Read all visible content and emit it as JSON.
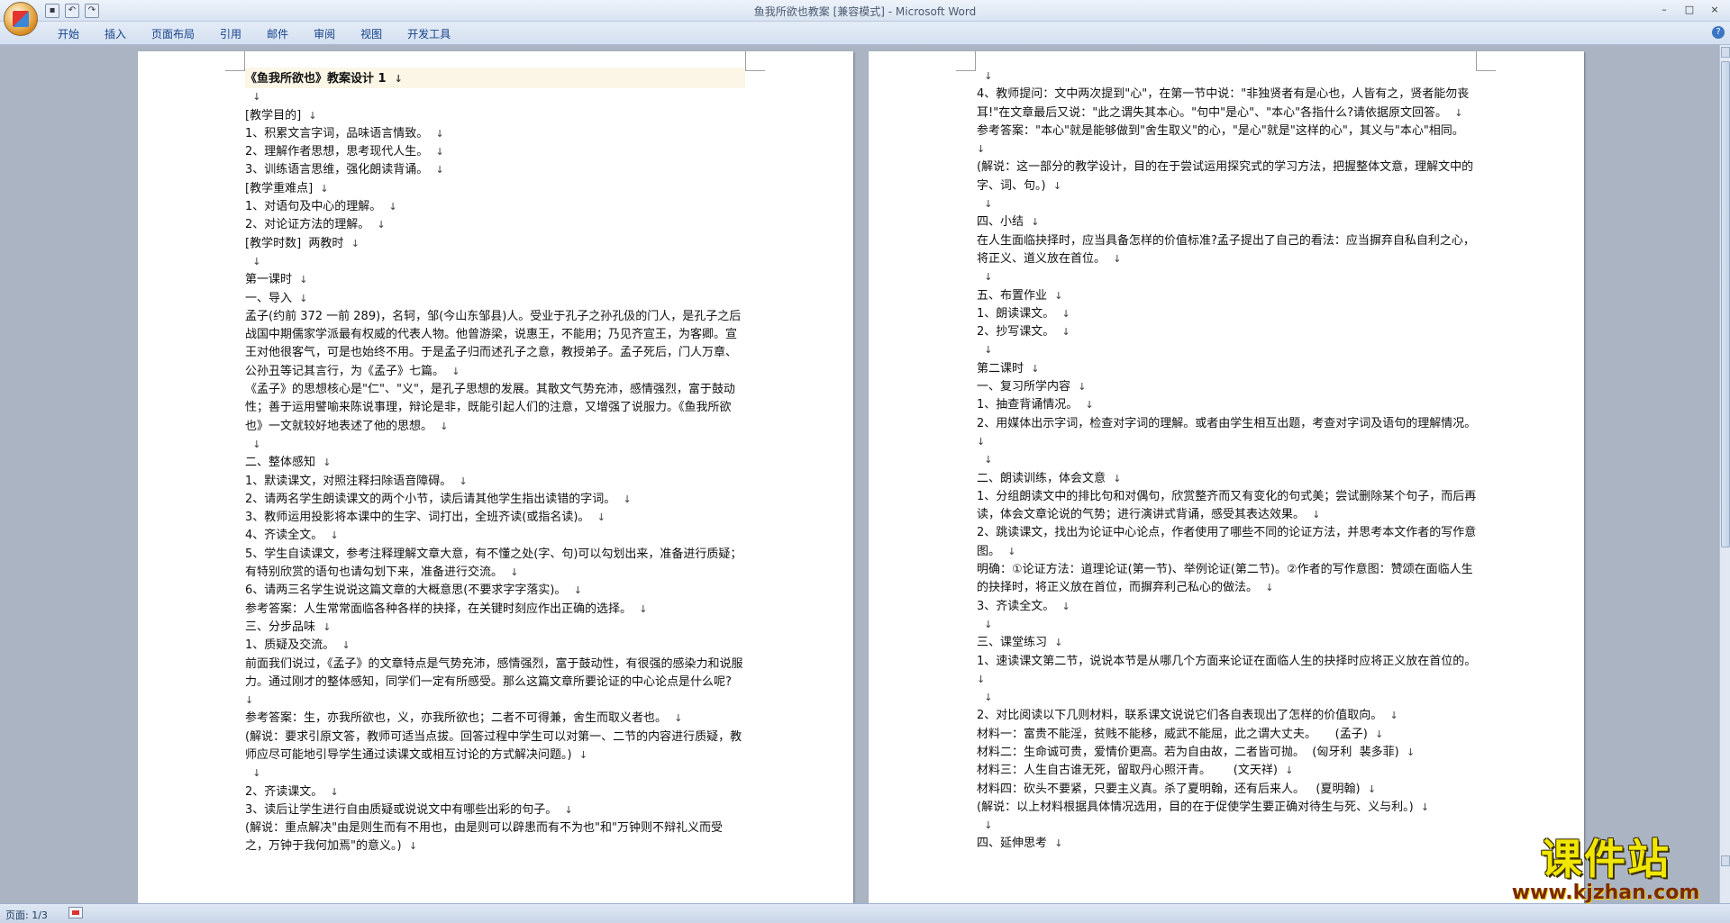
{
  "window": {
    "title": "鱼我所欲也教案 [兼容模式] - Microsoft Word",
    "controls": [
      "–",
      "□",
      "×"
    ]
  },
  "quick_access": {
    "save_icon": "save-icon",
    "undo_icon": "undo-icon",
    "redo_icon": "redo-icon"
  },
  "ribbon": {
    "tabs": [
      "开始",
      "插入",
      "页面布局",
      "引用",
      "邮件",
      "审阅",
      "视图",
      "开发工具"
    ],
    "help_label": "?"
  },
  "page1": {
    "paragraphs": [
      "《鱼我所欲也》教案设计 1",
      "",
      "[教学目的]",
      "1、积累文言字词，品味语言情致。",
      "2、理解作者思想，思考现代人生。",
      "3、训练语言思维，强化朗读背诵。",
      "[教学重难点]",
      "1、对语句及中心的理解。",
      "2、对论证方法的理解。",
      "[教学时数]  两教时",
      "",
      "第一课时",
      "一、导入",
      "孟子(约前 372 一前 289)，名轲，邹(今山东邹县)人。受业于孔子之孙孔伋的门人，是孔子之后战国中期儒家学派最有权威的代表人物。他曾游梁，说惠王，不能用；乃见齐宣王，为客卿。宣王对他很客气，可是也始终不用。于是孟子归而述孔子之意，教授弟子。孟子死后，门人万章、公孙丑等记其言行，为《孟子》七篇。",
      "《孟子》的思想核心是\"仁\"、\"义\"，是孔子思想的发展。其散文气势充沛，感情强烈，富于鼓动性；善于运用譬喻来陈说事理，辩论是非，既能引起人们的注意，又增强了说服力。《鱼我所欲也》一文就较好地表述了他的思想。",
      "",
      "二、整体感知",
      "1、默读课文，对照注释扫除语音障碍。",
      "2、请两名学生朗读课文的两个小节，读后请其他学生指出读错的字词。",
      "3、教师运用投影将本课中的生字、词打出，全班齐读(或指名读)。",
      "4、齐读全文。",
      "5、学生自读课文，参考注释理解文章大意，有不懂之处(字、句)可以勾划出来，准备进行质疑；有特别欣赏的语句也请勾划下来，准备进行交流。",
      "6、请两三名学生说说这篇文章的大概意思(不要求字字落实)。",
      "参考答案：人生常常面临各种各样的抉择，在关键时刻应作出正确的选择。",
      "三、分步品味",
      "1、质疑及交流。",
      "前面我们说过，《孟子》的文章特点是气势充沛，感情强烈，富于鼓动性，有很强的感染力和说服力。通过刚才的整体感知，同学们一定有所感受。那么这篇文章所要论证的中心论点是什么呢?",
      "参考答案：生，亦我所欲也，义，亦我所欲也；二者不可得兼，舍生而取义者也。",
      "(解说：要求引原文答，教师可适当点拔。回答过程中学生可以对第一、二节的内容进行质疑，教师应尽可能地引导学生通过读课文或相互讨论的方式解决问题。)",
      "",
      "2、齐读课文。",
      "3、读后让学生进行自由质疑或说说文中有哪些出彩的句子。",
      "(解说：重点解决\"由是则生而有不用也，由是则可以辟患而有不为也\"和\"万钟则不辩礼义而受之，万钟于我何加焉\"的意义。)"
    ]
  },
  "page2": {
    "paragraphs": [
      "",
      "4、教师提问：文中两次提到\"心\"，在第一节中说：\"非独贤者有是心也，人皆有之，贤者能勿丧耳!\"在文章最后又说：\"此之谓失其本心。\"句中\"是心\"、\"本心\"各指什么?请依据原文回答。",
      "参考答案：\"本心\"就是能够做到\"舍生取义\"的心，\"是心\"就是\"这样的心\"，其义与\"本心\"相同。",
      "(解说：这一部分的教学设计，目的在于尝试运用探究式的学习方法，把握整体文意，理解文中的字、词、句。)",
      "",
      "四、小结",
      "在人生面临抉择时，应当具备怎样的价值标准?孟子提出了自己的看法：应当摒弃自私自利之心，将正义、道义放在首位。",
      "",
      "五、布置作业",
      "1、朗读课文。",
      "2、抄写课文。",
      "",
      "第二课时",
      "一、复习所学内容",
      "1、抽查背诵情况。",
      "2、用媒体出示字词，检查对字词的理解。或者由学生相互出题，考查对字词及语句的理解情况。",
      "",
      "二、朗读训练，体会文意",
      "1、分组朗读文中的排比句和对偶句，欣赏整齐而又有变化的句式美；尝试删除某个句子，而后再读，体会文章论说的气势；进行演讲式背诵，感受其表达效果。",
      "2、跳读课文，找出为论证中心论点，作者使用了哪些不同的论证方法，并思考本文作者的写作意图。",
      "明确：①论证方法：道理论证(第一节)、举例论证(第二节)。②作者的写作意图：赞颂在面临人生的抉择时，将正义放在首位，而摒弃利己私心的做法。",
      "3、齐读全文。",
      "",
      "三、课堂练习",
      "1、速读课文第二节，说说本节是从哪几个方面来论证在面临人生的抉择时应将正义放在首位的。",
      "",
      "2、对比阅读以下几则材料，联系课文说说它们各自表现出了怎样的价值取向。",
      "材料一：富贵不能淫，贫贱不能移，威武不能屈，此之谓大丈夫。     (孟子)",
      "材料二：生命诚可贵，爱情价更高。若为自由故，二者皆可抛。  (匈牙利  裴多菲)",
      "材料三：人生自古谁无死，留取丹心照汗青。      (文天祥)",
      "材料四：砍头不要紧，只要主义真。杀了夏明翰，还有后来人。   (夏明翰)",
      "(解说：以上材料根据具体情况选用，目的在于促使学生要正确对待生与死、义与利。)",
      "",
      "四、延伸思考"
    ]
  },
  "paragraph_mark": "↓",
  "status": {
    "page_label": "页面: 1/3"
  },
  "watermark": {
    "title": "课件站",
    "url": "www.kjzhan.com"
  }
}
